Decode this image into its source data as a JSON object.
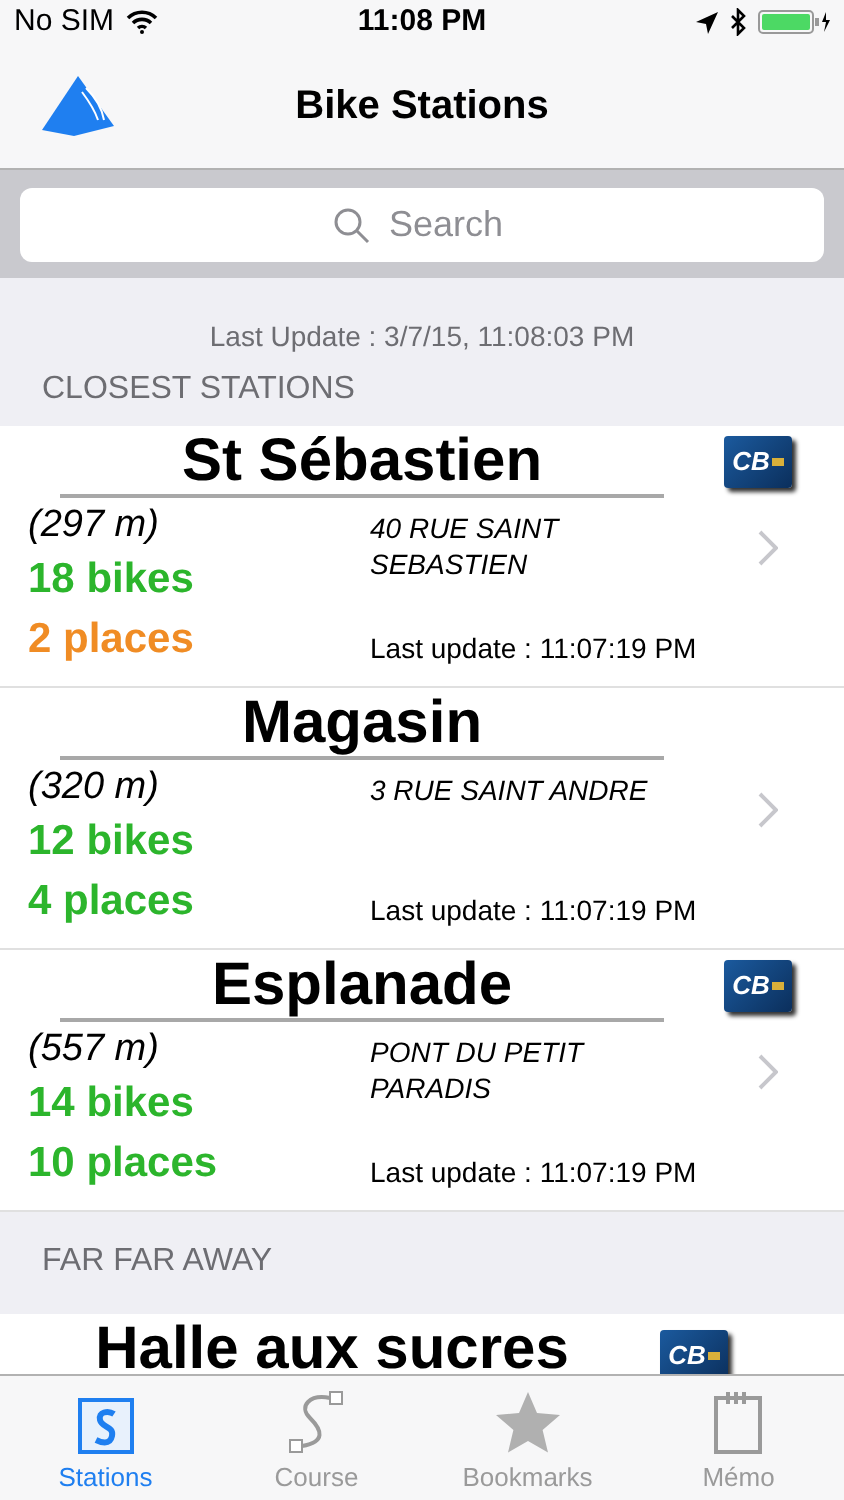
{
  "status_bar": {
    "carrier": "No SIM",
    "time": "11:08 PM"
  },
  "nav": {
    "title": "Bike Stations"
  },
  "search": {
    "placeholder": "Search"
  },
  "last_update": "Last Update : 3/7/15, 11:08:03 PM",
  "sections": [
    {
      "header": "CLOSEST STATIONS",
      "stations": [
        {
          "name": "St Sébastien",
          "badge": "CB",
          "distance": "(297 m)",
          "bikes": "18 bikes",
          "places": "2 places",
          "color": "#f08c24",
          "address": "40 RUE SAINT SEBASTIEN",
          "updated": "Last update : 11:07:19 PM"
        },
        {
          "name": "Magasin",
          "distance": "(320 m)",
          "bikes": "12 bikes",
          "places": "4 places",
          "color": "#2cb52c",
          "address": "3 RUE SAINT ANDRE",
          "updated": "Last update : 11:07:19 PM"
        },
        {
          "name": "Esplanade",
          "badge": "CB",
          "distance": "(557 m)",
          "bikes": "14 bikes",
          "places": "10 places",
          "color": "#2cb52c",
          "address": "PONT DU PETIT PARADIS",
          "updated": "Last update : 11:07:19 PM"
        }
      ]
    },
    {
      "header": "FAR FAR AWAY",
      "stations": [
        {
          "name": "Halle aux sucres",
          "badge": "CB",
          "partial": true
        }
      ]
    }
  ],
  "tabs": [
    {
      "label": "Stations",
      "kind": "stations",
      "selected": true
    },
    {
      "label": "Course",
      "kind": "course",
      "selected": false
    },
    {
      "label": "Bookmarks",
      "kind": "bookmarks",
      "selected": false
    },
    {
      "label": "Mémo",
      "kind": "memo",
      "selected": false
    }
  ]
}
